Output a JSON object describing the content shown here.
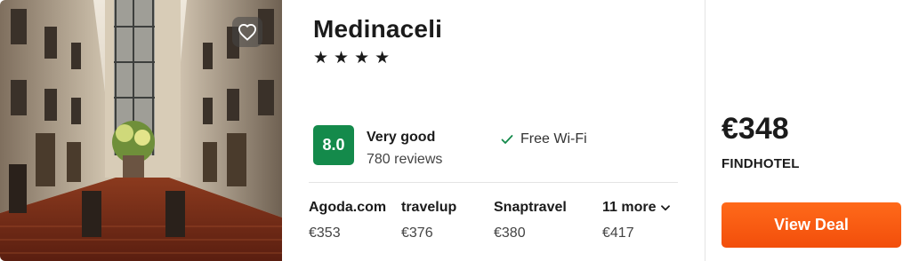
{
  "hotel": {
    "name": "Medinaceli",
    "stars": [
      "★",
      "★",
      "★",
      "★"
    ]
  },
  "rating": {
    "score": "8.0",
    "label": "Very good",
    "reviews": "780 reviews",
    "badge_color": "#148a4b"
  },
  "amenities": {
    "wifi": "Free Wi-Fi",
    "icon": "checkmark-icon"
  },
  "providers": [
    {
      "name": "Agoda.com",
      "price": "€353"
    },
    {
      "name": "travelup",
      "price": "€376"
    },
    {
      "name": "Snaptravel",
      "price": "€380"
    }
  ],
  "more_providers": {
    "label": "11 more",
    "price": "€417",
    "icon": "chevron-down-icon"
  },
  "deal": {
    "price": "€348",
    "provider": "FINDHOTEL",
    "button_label": "View Deal",
    "button_color": "#f24e0b"
  },
  "photo": {
    "favorite_icon": "heart-icon"
  }
}
